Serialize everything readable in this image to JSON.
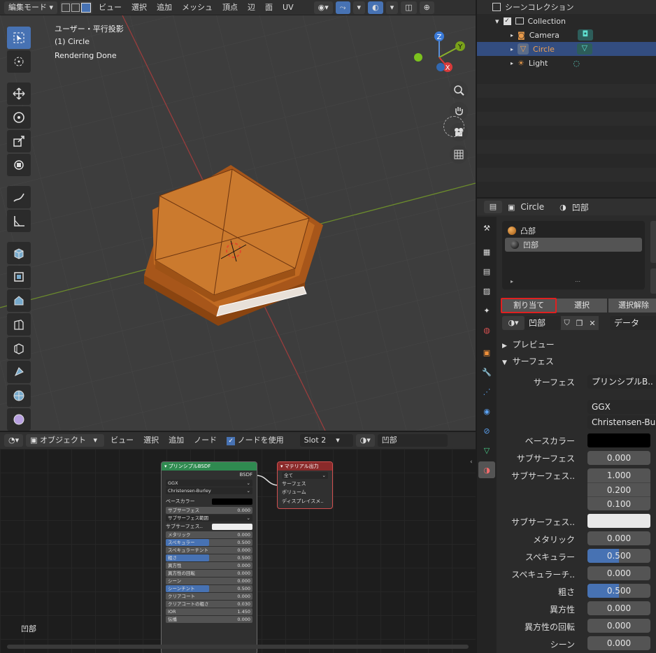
{
  "viewport": {
    "mode": "編集モード",
    "menus": [
      "ビュー",
      "選択",
      "追加",
      "メッシュ",
      "頂点",
      "辺",
      "面",
      "UV"
    ],
    "overlay_lines": [
      "ユーザー・平行投影",
      "(1) Circle",
      "Rendering Done"
    ],
    "gizmo": {
      "x": "X",
      "y": "Y",
      "z": "Z"
    }
  },
  "outliner": {
    "scene_collection": "シーンコレクション",
    "collection": "Collection",
    "items": [
      "Camera",
      "Circle",
      "Light"
    ]
  },
  "properties": {
    "object_name": "Circle",
    "material_name": "凹部",
    "slots": [
      "凸部",
      "凹部"
    ],
    "buttons": {
      "assign": "割り当て",
      "select": "選択",
      "deselect": "選択解除"
    },
    "material_field": "凹部",
    "link_mode": "データ",
    "panels": {
      "preview": "プレビュー",
      "surface": "サーフェス"
    },
    "rows": [
      {
        "label": "サーフェス",
        "value": "プリンシプルB.."
      },
      {
        "label": "",
        "value": "GGX"
      },
      {
        "label": "",
        "value": "Christensen-Burle"
      },
      {
        "label": "ベースカラー",
        "value": ""
      },
      {
        "label": "サブサーフェス",
        "value": "0.000"
      },
      {
        "label": "サブサーフェス..",
        "value": "1.000"
      },
      {
        "label": "",
        "value": "0.200"
      },
      {
        "label": "",
        "value": "0.100"
      },
      {
        "label": "サブサーフェス..",
        "value": ""
      },
      {
        "label": "メタリック",
        "value": "0.000"
      },
      {
        "label": "スペキュラー",
        "value": "0.500"
      },
      {
        "label": "スペキュラーチ..",
        "value": "0.000"
      },
      {
        "label": "粗さ",
        "value": "0.500"
      },
      {
        "label": "異方性",
        "value": "0.000"
      },
      {
        "label": "異方性の回転",
        "value": "0.000"
      },
      {
        "label": "シーン",
        "value": "0.000"
      }
    ],
    "progress": {
      "specular": 0.5,
      "roughness": 0.5
    }
  },
  "node_editor": {
    "object_mode": "オブジェクト",
    "menus": [
      "ビュー",
      "選択",
      "追加",
      "ノード"
    ],
    "use_nodes_label": "ノードを使用",
    "slot": "Slot 2",
    "material": "凹部",
    "corner_label": "凹部",
    "bsdf_node": {
      "title": "プリンシプルBSDF",
      "output": "BSDF",
      "dist": "GGX",
      "sss_method": "Christensen-Burley",
      "rows": [
        {
          "label": "ベースカラー",
          "value": ""
        },
        {
          "label": "サブサーフェス",
          "value": "0.000"
        },
        {
          "label": "サブサーフェス範囲",
          "value": ""
        },
        {
          "label": "サブサーフェス..",
          "value": ""
        },
        {
          "label": "メタリック",
          "value": "0.000"
        },
        {
          "label": "スペキュラー",
          "value": "0.500"
        },
        {
          "label": "スペキュラーチント",
          "value": "0.000"
        },
        {
          "label": "粗さ",
          "value": "0.500"
        },
        {
          "label": "異方性",
          "value": "0.000"
        },
        {
          "label": "異方性の回転",
          "value": "0.000"
        },
        {
          "label": "シーン",
          "value": "0.000"
        },
        {
          "label": "シーンチント",
          "value": "0.500"
        },
        {
          "label": "クリアコート",
          "value": "0.000"
        },
        {
          "label": "クリアコートの粗さ",
          "value": "0.030"
        },
        {
          "label": "IOR",
          "value": "1.450"
        },
        {
          "label": "伝播",
          "value": "0.000"
        }
      ]
    },
    "output_node": {
      "title": "マテリアル出力",
      "target": "全て",
      "inputs": [
        "サーフェス",
        "ボリューム",
        "ディスプレイスメ.."
      ]
    }
  },
  "colors": {
    "accent": "#4772b3",
    "orange": "#c8752a",
    "highlight": "#e02020"
  }
}
